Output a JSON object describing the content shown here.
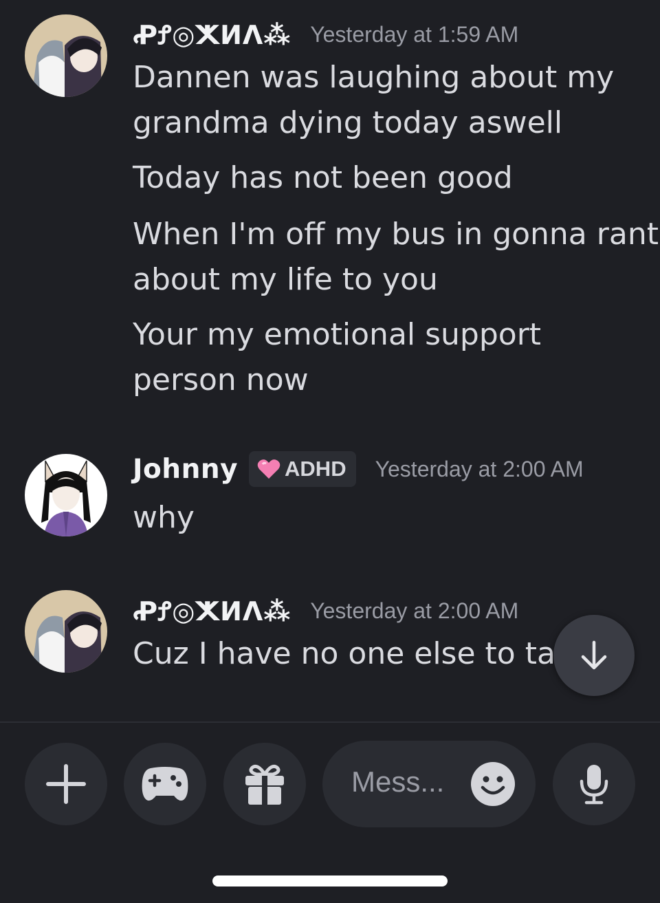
{
  "messages": [
    {
      "author": "ꝒꝬ◎ⵅⵍⴷ⁂",
      "timestamp": "Yesterday at 1:59 AM",
      "lines": [
        "Dannen was laughing about my",
        "grandma dying today aswell",
        "Today has not been good",
        "When I'm off my bus in gonna rant",
        "about my life to you",
        "Your my emotional support",
        "person now"
      ]
    },
    {
      "author": "Johnny",
      "tag": "ADHD",
      "tag_icon": "pink-heart-icon",
      "timestamp": "Yesterday at 2:00 AM",
      "lines": [
        "why"
      ]
    },
    {
      "author": "ꝒꝬ◎ⵅⵍⴷ⁂",
      "timestamp": "Yesterday at 2:00 AM",
      "lines": [
        "Cuz I have no one else to talk"
      ]
    }
  ],
  "composer": {
    "placeholder": "Mess...",
    "buttons": [
      "add-icon",
      "gamepad-icon",
      "gift-icon",
      "emoji-icon",
      "microphone-icon"
    ]
  },
  "scroll_button_icon": "arrow-down-icon",
  "colors": {
    "background": "#1e1f24",
    "text": "#dadbe0",
    "timestamp": "#9a9ca5",
    "button_bg": "#2a2c32",
    "tag_heart": "#f47fb3"
  }
}
